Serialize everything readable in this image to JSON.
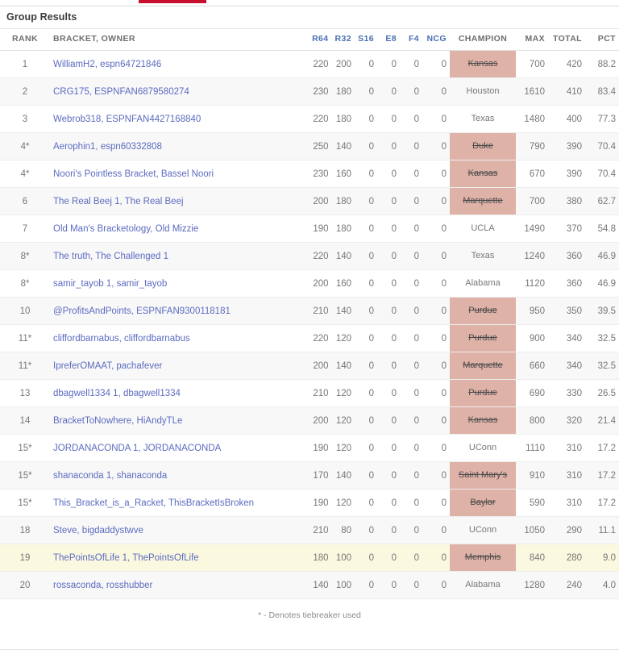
{
  "tabstrip": {
    "active_indicator_color": "#c8102e"
  },
  "page_title": "Group Results",
  "table": {
    "headers": {
      "rank": "RANK",
      "owner": "BRACKET, OWNER",
      "r64": "R64",
      "r32": "R32",
      "s16": "S16",
      "e8": "E8",
      "f4": "F4",
      "ncg": "NCG",
      "champion": "CHAMPION",
      "max": "MAX",
      "total": "TOTAL",
      "pct": "PCT"
    },
    "rows": [
      {
        "rank": "1",
        "owner": "WilliamH2, espn64721846",
        "r64": "220",
        "r32": "200",
        "s16": "0",
        "e8": "0",
        "f4": "0",
        "ncg": "0",
        "champion": "Kansas",
        "eliminated": true,
        "max": "700",
        "total": "420",
        "pct": "88.2",
        "mine": false
      },
      {
        "rank": "2",
        "owner": "CRG175, ESPNFAN6879580274",
        "r64": "230",
        "r32": "180",
        "s16": "0",
        "e8": "0",
        "f4": "0",
        "ncg": "0",
        "champion": "Houston",
        "eliminated": false,
        "max": "1610",
        "total": "410",
        "pct": "83.4",
        "mine": false
      },
      {
        "rank": "3",
        "owner": "Webrob318, ESPNFAN4427168840",
        "r64": "220",
        "r32": "180",
        "s16": "0",
        "e8": "0",
        "f4": "0",
        "ncg": "0",
        "champion": "Texas",
        "eliminated": false,
        "max": "1480",
        "total": "400",
        "pct": "77.3",
        "mine": false
      },
      {
        "rank": "4*",
        "owner": "Aerophin1, espn60332808",
        "r64": "250",
        "r32": "140",
        "s16": "0",
        "e8": "0",
        "f4": "0",
        "ncg": "0",
        "champion": "Duke",
        "eliminated": true,
        "max": "790",
        "total": "390",
        "pct": "70.4",
        "mine": false
      },
      {
        "rank": "4*",
        "owner": "Noori's Pointless Bracket,  Bassel Noori",
        "r64": "230",
        "r32": "160",
        "s16": "0",
        "e8": "0",
        "f4": "0",
        "ncg": "0",
        "champion": "Kansas",
        "eliminated": true,
        "max": "670",
        "total": "390",
        "pct": "70.4",
        "mine": false
      },
      {
        "rank": "6",
        "owner": "The Real Beej 1,  The Real Beej",
        "r64": "200",
        "r32": "180",
        "s16": "0",
        "e8": "0",
        "f4": "0",
        "ncg": "0",
        "champion": "Marquette",
        "eliminated": true,
        "max": "700",
        "total": "380",
        "pct": "62.7",
        "mine": false
      },
      {
        "rank": "7",
        "owner": "Old Man's Bracketology,  Old Mizzie",
        "r64": "190",
        "r32": "180",
        "s16": "0",
        "e8": "0",
        "f4": "0",
        "ncg": "0",
        "champion": "UCLA",
        "eliminated": false,
        "max": "1490",
        "total": "370",
        "pct": "54.8",
        "mine": false
      },
      {
        "rank": "8*",
        "owner": "The truth,  The Challenged 1",
        "r64": "220",
        "r32": "140",
        "s16": "0",
        "e8": "0",
        "f4": "0",
        "ncg": "0",
        "champion": "Texas",
        "eliminated": false,
        "max": "1240",
        "total": "360",
        "pct": "46.9",
        "mine": false
      },
      {
        "rank": "8*",
        "owner": "samir_tayob 1,  samir_tayob",
        "r64": "200",
        "r32": "160",
        "s16": "0",
        "e8": "0",
        "f4": "0",
        "ncg": "0",
        "champion": "Alabama",
        "eliminated": false,
        "max": "1120",
        "total": "360",
        "pct": "46.9",
        "mine": false
      },
      {
        "rank": "10",
        "owner": "@ProfitsAndPoints, ESPNFAN9300118181",
        "r64": "210",
        "r32": "140",
        "s16": "0",
        "e8": "0",
        "f4": "0",
        "ncg": "0",
        "champion": "Purdue",
        "eliminated": true,
        "max": "950",
        "total": "350",
        "pct": "39.5",
        "mine": false
      },
      {
        "rank": "11*",
        "owner": "cliffordbarnabus, cliffordbarnabus",
        "r64": "220",
        "r32": "120",
        "s16": "0",
        "e8": "0",
        "f4": "0",
        "ncg": "0",
        "champion": "Purdue",
        "eliminated": true,
        "max": "900",
        "total": "340",
        "pct": "32.5",
        "mine": false
      },
      {
        "rank": "11*",
        "owner": "IpreferOMAAT, pachafever",
        "r64": "200",
        "r32": "140",
        "s16": "0",
        "e8": "0",
        "f4": "0",
        "ncg": "0",
        "champion": "Marquette",
        "eliminated": true,
        "max": "660",
        "total": "340",
        "pct": "32.5",
        "mine": false
      },
      {
        "rank": "13",
        "owner": "dbagwell1334 1, dbagwell1334",
        "r64": "210",
        "r32": "120",
        "s16": "0",
        "e8": "0",
        "f4": "0",
        "ncg": "0",
        "champion": "Purdue",
        "eliminated": true,
        "max": "690",
        "total": "330",
        "pct": "26.5",
        "mine": false
      },
      {
        "rank": "14",
        "owner": "BracketToNowhere, HiAndyTLe",
        "r64": "200",
        "r32": "120",
        "s16": "0",
        "e8": "0",
        "f4": "0",
        "ncg": "0",
        "champion": "Kansas",
        "eliminated": true,
        "max": "800",
        "total": "320",
        "pct": "21.4",
        "mine": false
      },
      {
        "rank": "15*",
        "owner": "JORDANACONDA 1,  JORDANACONDA",
        "r64": "190",
        "r32": "120",
        "s16": "0",
        "e8": "0",
        "f4": "0",
        "ncg": "0",
        "champion": "UConn",
        "eliminated": false,
        "max": "1110",
        "total": "310",
        "pct": "17.2",
        "mine": false
      },
      {
        "rank": "15*",
        "owner": "shanaconda 1,  shanaconda",
        "r64": "170",
        "r32": "140",
        "s16": "0",
        "e8": "0",
        "f4": "0",
        "ncg": "0",
        "champion": "Saint Mary's",
        "eliminated": true,
        "max": "910",
        "total": "310",
        "pct": "17.2",
        "mine": false
      },
      {
        "rank": "15*",
        "owner": "This_Bracket_is_a_Racket,  ThisBracketIsBroken",
        "r64": "190",
        "r32": "120",
        "s16": "0",
        "e8": "0",
        "f4": "0",
        "ncg": "0",
        "champion": "Baylor",
        "eliminated": true,
        "max": "590",
        "total": "310",
        "pct": "17.2",
        "mine": false
      },
      {
        "rank": "18",
        "owner": "Steve,  bigdaddystwve",
        "r64": "210",
        "r32": "80",
        "s16": "0",
        "e8": "0",
        "f4": "0",
        "ncg": "0",
        "champion": "UConn",
        "eliminated": false,
        "max": "1050",
        "total": "290",
        "pct": "11.1",
        "mine": false
      },
      {
        "rank": "19",
        "owner": "ThePointsOfLife 1,  ThePointsOfLife",
        "r64": "180",
        "r32": "100",
        "s16": "0",
        "e8": "0",
        "f4": "0",
        "ncg": "0",
        "champion": "Memphis",
        "eliminated": true,
        "max": "840",
        "total": "280",
        "pct": "9.0",
        "mine": true
      },
      {
        "rank": "20",
        "owner": "rossaconda,  rosshubber",
        "r64": "140",
        "r32": "100",
        "s16": "0",
        "e8": "0",
        "f4": "0",
        "ncg": "0",
        "champion": "Alabama",
        "eliminated": false,
        "max": "1280",
        "total": "240",
        "pct": "4.0",
        "mine": false
      }
    ]
  },
  "footnote": "* - Denotes tiebreaker used",
  "colors": {
    "eliminated_bg": "#dfb2a8",
    "my_row_bg": "#fbf8e0",
    "link": "#5c6bc0",
    "accent_red": "#c8102e"
  }
}
